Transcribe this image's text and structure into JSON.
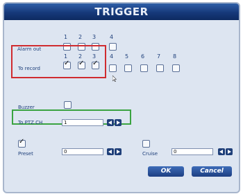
{
  "title": "TRIGGER",
  "alarm_out": {
    "label": "Alarm out",
    "channels": [
      "1",
      "2",
      "3",
      "4"
    ]
  },
  "to_record": {
    "label": "To record",
    "channels": [
      "1",
      "2",
      "3",
      "4",
      "5",
      "6",
      "7",
      "8"
    ],
    "checked": [
      "1",
      "2",
      "3"
    ]
  },
  "buzzer": {
    "label": "Buzzer",
    "checked": false
  },
  "to_ptz": {
    "label": "To PTZ CH",
    "value": "1"
  },
  "preset": {
    "label": "Preset",
    "value": "0",
    "checked": true
  },
  "cruise": {
    "label": "Cruise",
    "value": "0",
    "checked": false
  },
  "buttons": {
    "ok": "OK",
    "cancel": "Cancel"
  },
  "colors": {
    "title_bar": "#16397a",
    "dialog_bg": "#dde5f1",
    "label": "#1e3f7a",
    "highlight_red": "#d02b2f",
    "highlight_green": "#3aa341"
  }
}
